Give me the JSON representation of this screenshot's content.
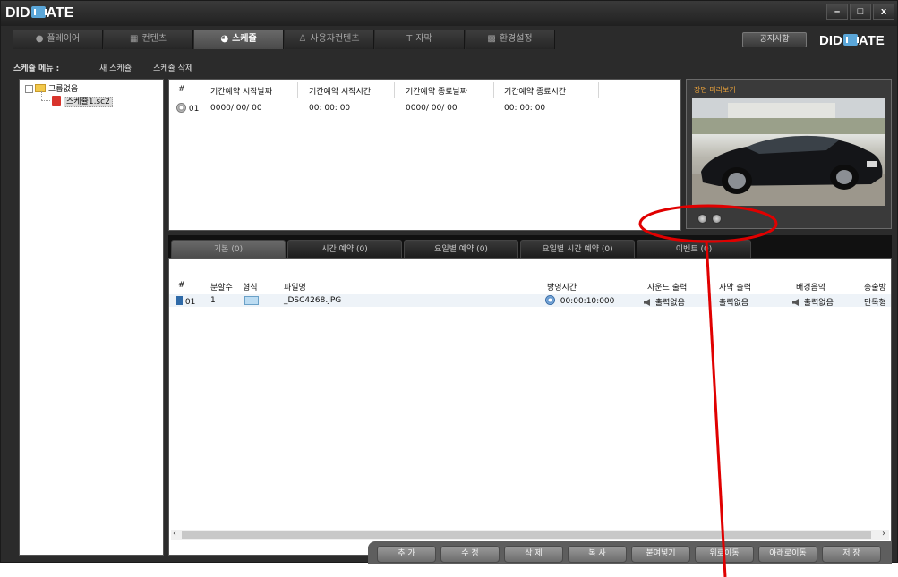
{
  "app": {
    "title_left": "DID",
    "title_right": "ATE",
    "window_buttons": {
      "minimize": "–",
      "maximize": "□",
      "close": "x"
    }
  },
  "main_tabs": [
    {
      "label": "플레이어",
      "icon": "play-icon",
      "glyph": "●"
    },
    {
      "label": "컨텐츠",
      "icon": "content-icon",
      "glyph": "▦"
    },
    {
      "label": "스케쥴",
      "icon": "schedule-icon",
      "glyph": "◕"
    },
    {
      "label": "사용자컨텐츠",
      "icon": "user-icon",
      "glyph": "♙"
    },
    {
      "label": "자막",
      "icon": "text-icon",
      "glyph": "T"
    },
    {
      "label": "환경설정",
      "icon": "settings-icon",
      "glyph": "▩"
    }
  ],
  "notice_button": "공지사항",
  "brand": {
    "left": "DID",
    "right": "ATE"
  },
  "menu": {
    "label": "스케쥴 메뉴 :",
    "new_schedule": "새 스케쥴",
    "delete_schedule": "스케쥴 삭제"
  },
  "tree": {
    "group": "그룹없음",
    "file": "스케쥴1.sc2"
  },
  "schedule_table": {
    "headers": [
      "#",
      "기간예약 시작날짜",
      "기간예약 시작시간",
      "기간예약 종료날짜",
      "기간예약 종료시간"
    ],
    "rows": [
      {
        "num": "01",
        "start_date": "0000/ 00/ 00",
        "start_time": "00: 00: 00",
        "end_date": "0000/ 00/ 00",
        "end_time": "00: 00: 00"
      }
    ]
  },
  "preview": {
    "title": "장면 미리보기"
  },
  "sub_tabs": [
    {
      "label": "기본 (0)"
    },
    {
      "label": "시간 예약 (0)"
    },
    {
      "label": "요일별 예약 (0)"
    },
    {
      "label": "요일별 시간 예약 (0)"
    },
    {
      "label": "이벤트 (0)"
    }
  ],
  "content_table": {
    "headers": [
      "#",
      "분할수",
      "형식",
      "파일명",
      "방영시간",
      "사운드 출력",
      "자막 출력",
      "배경음악",
      "송출방"
    ],
    "rows": [
      {
        "num": "01",
        "split": "1",
        "filename": "_DSC4268.JPG",
        "duration": "00:00:10:000",
        "sound": "출력없음",
        "subtitle": "출력없음",
        "bgm": "출력없음",
        "output": "단독형"
      }
    ]
  },
  "actions": [
    "추 가",
    "수 정",
    "삭 제",
    "복 사",
    "붙여넣기",
    "위로이동",
    "아래로이동",
    "저 장"
  ],
  "annotation_color": "#e00000"
}
